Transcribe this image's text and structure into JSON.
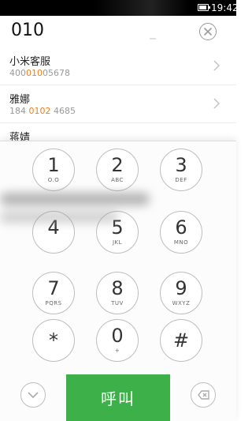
{
  "status_bar": {
    "time": "19:42"
  },
  "dialer": {
    "input_value": "010"
  },
  "results": [
    {
      "name": "小米客服",
      "num_pre": "400",
      "num_hl": "010",
      "num_post": "05678"
    },
    {
      "name": "雅娜",
      "num_pre": "184 ",
      "num_hl": "0102",
      "num_post": " 4685"
    },
    {
      "name": "蒋婧",
      "num_pre": "",
      "num_hl": "",
      "num_post": ""
    }
  ],
  "keys": [
    {
      "digit": "1",
      "letters": "O.O"
    },
    {
      "digit": "2",
      "letters": "ABC"
    },
    {
      "digit": "3",
      "letters": "DEF"
    },
    {
      "digit": "4",
      "letters": ""
    },
    {
      "digit": "5",
      "letters": "JKL"
    },
    {
      "digit": "6",
      "letters": "MNO"
    },
    {
      "digit": "7",
      "letters": "PQRS"
    },
    {
      "digit": "8",
      "letters": "TUV"
    },
    {
      "digit": "9",
      "letters": "WXYZ"
    },
    {
      "digit": "*",
      "letters": ""
    },
    {
      "digit": "0",
      "letters": "+"
    },
    {
      "digit": "#",
      "letters": ""
    }
  ],
  "call_button": {
    "label": "呼叫"
  },
  "colors": {
    "call_green": "#3db04a",
    "highlight_orange": "#e8801f"
  }
}
